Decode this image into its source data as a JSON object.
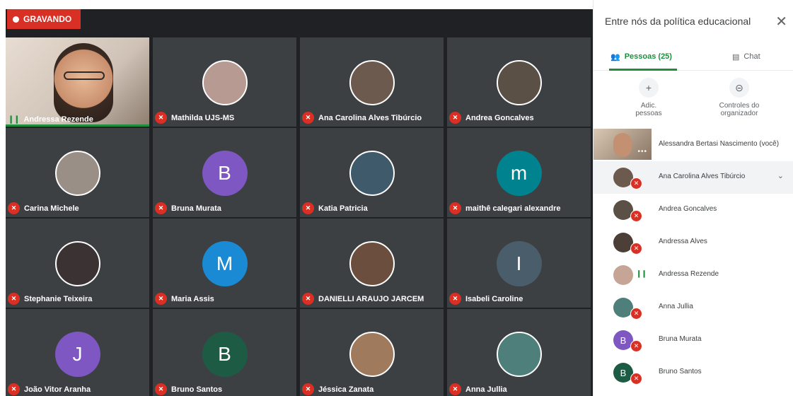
{
  "recording": {
    "label": "GRAVANDO",
    "color": "#d93025"
  },
  "grid": {
    "tiles": [
      {
        "name": "Andressa Rezende",
        "mic": "on",
        "self_video": true
      },
      {
        "name": "Mathilda UJS-MS",
        "mic": "off",
        "avatar_color": "#b79a92",
        "initial": ""
      },
      {
        "name": "Ana Carolina Alves Tibúrcio",
        "mic": "off",
        "avatar_color": "#6d5a4e",
        "initial": ""
      },
      {
        "name": "Andrea Goncalves",
        "mic": "off",
        "avatar_color": "#5b5046",
        "initial": ""
      },
      {
        "name": "Carina Michele",
        "mic": "off",
        "avatar_color": "#9a8f86",
        "initial": ""
      },
      {
        "name": "Bruna Murata",
        "mic": "off",
        "avatar_color": "#7e57c2",
        "initial": "B"
      },
      {
        "name": "Katia Patricia",
        "mic": "off",
        "avatar_color": "#3f5a6a",
        "initial": ""
      },
      {
        "name": "maithê calegari alexandre",
        "mic": "off",
        "avatar_color": "#00838f",
        "initial": "m"
      },
      {
        "name": "Stephanie Teixeira",
        "mic": "off",
        "avatar_color": "#3b3333",
        "initial": ""
      },
      {
        "name": "Maria Assis",
        "mic": "off",
        "avatar_color": "#1a8ad4",
        "initial": "M"
      },
      {
        "name": "DANIELLI ARAUJO JARCEM",
        "mic": "off",
        "avatar_color": "#6b4e3d",
        "initial": ""
      },
      {
        "name": "Isabeli Caroline",
        "mic": "off",
        "avatar_color": "#4a5d6b",
        "initial": "I"
      },
      {
        "name": "João Vitor Aranha",
        "mic": "off",
        "avatar_color": "#7e57c2",
        "initial": "J"
      },
      {
        "name": "Bruno Santos",
        "mic": "off",
        "avatar_color": "#1e5b45",
        "initial": "B"
      },
      {
        "name": "Jéssica Zanata",
        "mic": "off",
        "avatar_color": "#a07a5d",
        "initial": ""
      },
      {
        "name": "Anna Jullia",
        "mic": "off",
        "avatar_color": "#4f7f7a",
        "initial": ""
      }
    ]
  },
  "panel": {
    "title": "Entre nós da política educacional",
    "close_icon": "close-icon",
    "tabs": {
      "people": "Pessoas (25)",
      "chat": "Chat"
    },
    "actions": {
      "add": "Adic.\npessoas",
      "host": "Controles do\norganizador"
    },
    "people": [
      {
        "name": "Alessandra Bertasi Nascimento (você)",
        "self": true
      },
      {
        "name": "Ana Carolina Alves Tibúrcio",
        "mic": "off",
        "avatar_color": "#6d5a4e",
        "initial": "",
        "highlight": true
      },
      {
        "name": "Andrea Goncalves",
        "mic": "off",
        "avatar_color": "#5b5046",
        "initial": ""
      },
      {
        "name": "Andressa Alves",
        "mic": "off",
        "avatar_color": "#4b3f38",
        "initial": ""
      },
      {
        "name": "Andressa Rezende",
        "mic": "on",
        "avatar_color": "#c6a596",
        "initial": ""
      },
      {
        "name": "Anna Jullia",
        "mic": "off",
        "avatar_color": "#4f7f7a",
        "initial": ""
      },
      {
        "name": "Bruna Murata",
        "mic": "off",
        "avatar_color": "#7e57c2",
        "initial": "B"
      },
      {
        "name": "Bruno Santos",
        "mic": "off",
        "avatar_color": "#1e5b45",
        "initial": "B"
      }
    ]
  }
}
